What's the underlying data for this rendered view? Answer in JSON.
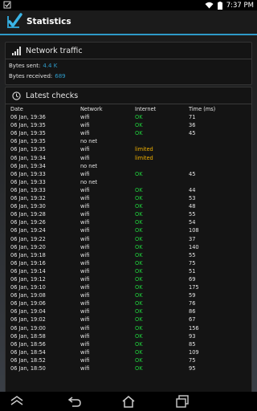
{
  "statusbar": {
    "time": "7:37 PM"
  },
  "app": {
    "title": "Statistics"
  },
  "traffic": {
    "header": "Network traffic",
    "bytes_sent_label": "Bytes sent:",
    "bytes_sent_value": "4.4 K",
    "bytes_received_label": "Bytes received:",
    "bytes_received_value": "689"
  },
  "checks": {
    "header": "Latest checks",
    "columns": [
      "Date",
      "Network",
      "Internet",
      "Time (ms)"
    ],
    "rows": [
      [
        "06 Jan, 19:36",
        "wifi",
        "OK",
        "71"
      ],
      [
        "06 Jan, 19:35",
        "wifi",
        "OK",
        "36"
      ],
      [
        "06 Jan, 19:35",
        "wifi",
        "OK",
        "45"
      ],
      [
        "06 Jan, 19:35",
        "no net",
        "",
        ""
      ],
      [
        "06 Jan, 19:35",
        "wifi",
        "limited",
        ""
      ],
      [
        "06 Jan, 19:34",
        "wifi",
        "limited",
        ""
      ],
      [
        "06 Jan, 19:34",
        "no net",
        "",
        ""
      ],
      [
        "06 Jan, 19:33",
        "wifi",
        "OK",
        "45"
      ],
      [
        "06 Jan, 19:33",
        "no net",
        "",
        ""
      ],
      [
        "06 Jan, 19:33",
        "wifi",
        "OK",
        "44"
      ],
      [
        "06 Jan, 19:32",
        "wifi",
        "OK",
        "53"
      ],
      [
        "06 Jan, 19:30",
        "wifi",
        "OK",
        "48"
      ],
      [
        "06 Jan, 19:28",
        "wifi",
        "OK",
        "55"
      ],
      [
        "06 Jan, 19:26",
        "wifi",
        "OK",
        "54"
      ],
      [
        "06 Jan, 19:24",
        "wifi",
        "OK",
        "108"
      ],
      [
        "06 Jan, 19:22",
        "wifi",
        "OK",
        "37"
      ],
      [
        "06 Jan, 19:20",
        "wifi",
        "OK",
        "140"
      ],
      [
        "06 Jan, 19:18",
        "wifi",
        "OK",
        "55"
      ],
      [
        "06 Jan, 19:16",
        "wifi",
        "OK",
        "75"
      ],
      [
        "06 Jan, 19:14",
        "wifi",
        "OK",
        "51"
      ],
      [
        "06 Jan, 19:12",
        "wifi",
        "OK",
        "69"
      ],
      [
        "06 Jan, 19:10",
        "wifi",
        "OK",
        "175"
      ],
      [
        "06 Jan, 19:08",
        "wifi",
        "OK",
        "59"
      ],
      [
        "06 Jan, 19:06",
        "wifi",
        "OK",
        "76"
      ],
      [
        "06 Jan, 19:04",
        "wifi",
        "OK",
        "86"
      ],
      [
        "06 Jan, 19:02",
        "wifi",
        "OK",
        "67"
      ],
      [
        "06 Jan, 19:00",
        "wifi",
        "OK",
        "156"
      ],
      [
        "06 Jan, 18:58",
        "wifi",
        "OK",
        "93"
      ],
      [
        "06 Jan, 18:56",
        "wifi",
        "OK",
        "85"
      ],
      [
        "06 Jan, 18:54",
        "wifi",
        "OK",
        "109"
      ],
      [
        "06 Jan, 18:52",
        "wifi",
        "OK",
        "75"
      ],
      [
        "06 Jan, 18:50",
        "wifi",
        "OK",
        "95"
      ]
    ]
  },
  "colors": {
    "accent": "#2e9ac8",
    "ok": "#1fd33c",
    "limited": "#f0b000"
  },
  "icons": [
    "notification-icon",
    "wifi-icon",
    "battery-icon",
    "app-checkmark-icon",
    "signal-bars-icon",
    "clock-icon",
    "back-icon",
    "home-icon",
    "recent-apps-icon",
    "collapse-icon"
  ]
}
